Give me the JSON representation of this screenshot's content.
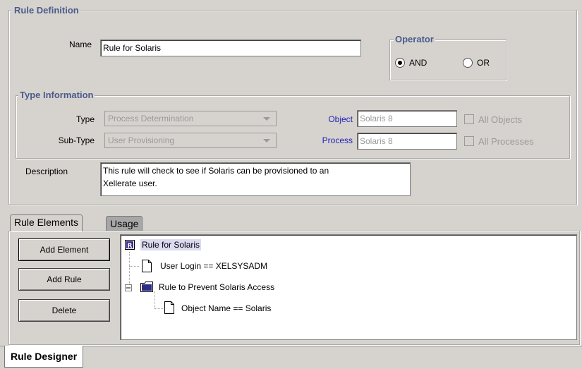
{
  "rule_definition": {
    "legend": "Rule Definition",
    "name_label": "Name",
    "name_value": "Rule for Solaris",
    "operator": {
      "legend": "Operator",
      "options": [
        "AND",
        "OR"
      ],
      "selected": "AND"
    },
    "type_information": {
      "legend": "Type Information",
      "type_label": "Type",
      "type_value": "Process Determination",
      "subtype_label": "Sub-Type",
      "subtype_value": "User Provisioning",
      "object_label": "Object",
      "object_value": "Solaris 8",
      "all_objects_label": "All Objects",
      "process_label": "Process",
      "process_value": "Solaris 8",
      "all_processes_label": "All Processes"
    },
    "description_label": "Description",
    "description_line1": "This rule will check to see if Solaris can be provisioned to an",
    "description_line2": "Xellerate user."
  },
  "tabs": {
    "rule_elements": "Rule Elements",
    "usage": "Usage"
  },
  "buttons": {
    "add_element": "Add Element",
    "add_rule": "Add Rule",
    "delete": "Delete"
  },
  "tree": {
    "root": "Rule for Solaris",
    "nodes": [
      "User Login == XELSYSADM",
      "Rule to Prevent Solaris Access",
      "Object Name == Solaris"
    ]
  },
  "bottom_tab": "Rule Designer",
  "colors": {
    "background": "#d6d3ce",
    "legend": "#4b5b8c",
    "link_label": "#1f1fb4",
    "usage_tab": "#a7a7a7"
  },
  "icons": {
    "root": "rule-icon",
    "leaf": "document-icon",
    "folder": "folder-icon",
    "collapse": "minus-expander-icon"
  }
}
